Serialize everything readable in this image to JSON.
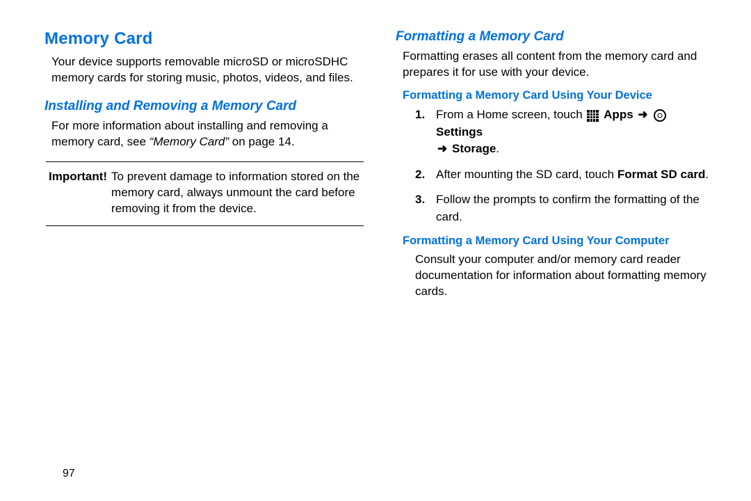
{
  "left": {
    "title": "Memory Card",
    "intro": "Your device supports removable microSD or microSDHC memory cards for storing music, photos, videos, and files.",
    "install_heading": "Installing and Removing a Memory Card",
    "install_text_a": "For more information about installing and removing a memory card, see ",
    "install_ref": "“Memory Card”",
    "install_text_b": " on page 14.",
    "note_label": "Important!",
    "note_text": "To prevent damage to information stored on the memory card, always unmount the card before removing it from the device."
  },
  "right": {
    "format_heading": "Formatting a Memory Card",
    "format_intro": "Formatting erases all content from the memory card and prepares it for use with your device.",
    "device_heading": "Formatting a Memory Card Using Your Device",
    "steps": {
      "s1_a": "From a Home screen, touch ",
      "s1_apps": "Apps",
      "s1_arrow1": "➜",
      "s1_settings": "Settings",
      "s1_arrow2": "➜",
      "s1_storage": "Storage",
      "s1_end": ".",
      "s2_a": "After mounting the SD card, touch ",
      "s2_b": "Format SD card",
      "s2_c": ".",
      "s3": "Follow the prompts to confirm the formatting of the card."
    },
    "computer_heading": "Formatting a Memory Card Using Your Computer",
    "computer_text": "Consult your computer and/or memory card reader documentation for information about formatting memory cards."
  },
  "page": "97"
}
